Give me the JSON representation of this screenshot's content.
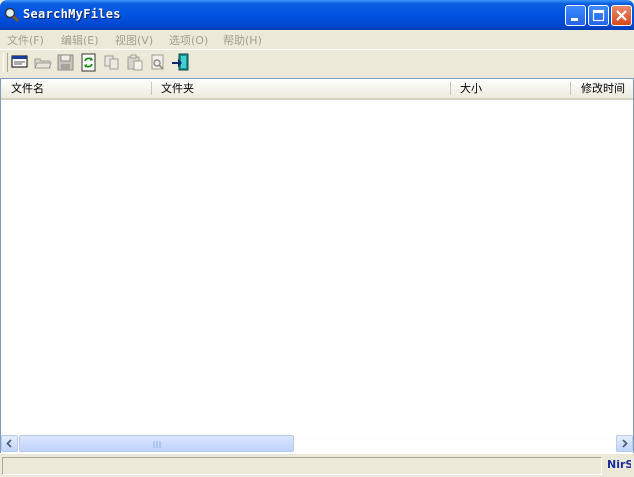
{
  "window": {
    "title": "SearchMyFiles"
  },
  "menu": {
    "items": [
      "文件(F)",
      "编辑(E)",
      "视图(V)",
      "选项(O)",
      "帮助(H)"
    ]
  },
  "toolbar": {
    "buttons": [
      {
        "icon": "search-options-icon"
      },
      {
        "icon": "open-folder-icon"
      },
      {
        "icon": "save-icon"
      },
      {
        "icon": "refresh-icon"
      },
      {
        "icon": "copy-icon"
      },
      {
        "icon": "paste-icon"
      },
      {
        "icon": "properties-icon"
      },
      {
        "icon": "exit-icon"
      }
    ]
  },
  "list": {
    "columns": [
      "文件名",
      "文件夹",
      "大小",
      "修改时间"
    ],
    "rows": []
  },
  "status": {
    "text": "",
    "brand": "NirSoft"
  },
  "colors": {
    "titlebar": "#0054E3",
    "menu_disabled": "#A29F90",
    "brand": "#1E2E9E"
  }
}
